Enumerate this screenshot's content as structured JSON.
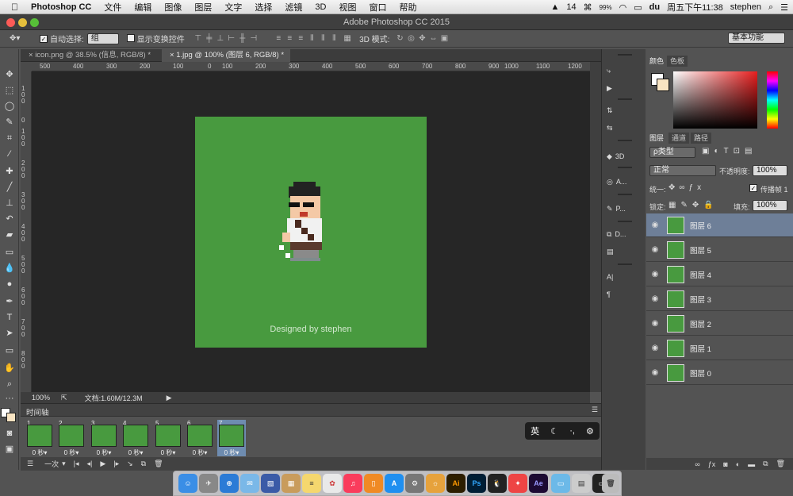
{
  "menubar": {
    "apple": "",
    "app": "Photoshop CC",
    "items": [
      "文件",
      "编辑",
      "图像",
      "图层",
      "文字",
      "选择",
      "滤镜",
      "3D",
      "视图",
      "窗口",
      "帮助"
    ],
    "status": {
      "adobe_count": "14",
      "wechat": "⌘",
      "battery": "99%",
      "clock": "周五下午11:38",
      "user": "stephen"
    }
  },
  "window": {
    "title": "Adobe Photoshop CC 2015"
  },
  "options": {
    "auto_select_label": "自动选择:",
    "auto_select_value": "组",
    "show_transform_label": "显示变换控件",
    "mode3d_label": "3D 模式:",
    "workspace": "基本功能"
  },
  "tabs": [
    {
      "label": "icon.png @ 38.5% (信息, RGB/8) *"
    },
    {
      "label": "1.jpg @ 100% (图层 6, RGB/8) *"
    }
  ],
  "ruler": {
    "h": [
      "500",
      "400",
      "300",
      "200",
      "100",
      "0",
      "100",
      "200",
      "300",
      "400",
      "500",
      "600",
      "700",
      "800",
      "900",
      "1000",
      "1100",
      "1200"
    ],
    "v": [
      "1 0 0",
      "0",
      "1 0 0",
      "2 0 0",
      "3 0 0",
      "4 0 0",
      "5 0 0",
      "6 0 0",
      "7 0 0",
      "8 0 0"
    ]
  },
  "canvas": {
    "bg_color": "#489a3f",
    "credit": "Designed by stephen"
  },
  "docstatus": {
    "zoom": "100%",
    "doc": "文档:1.60M/12.3M"
  },
  "timeline": {
    "title": "时间轴",
    "frames": [
      {
        "n": "1",
        "d": "0 秒▾"
      },
      {
        "n": "2",
        "d": "0 秒▾"
      },
      {
        "n": "3",
        "d": "0 秒▾"
      },
      {
        "n": "4",
        "d": "0 秒▾"
      },
      {
        "n": "5",
        "d": "0 秒▾"
      },
      {
        "n": "6",
        "d": "0 秒▾"
      },
      {
        "n": "7",
        "d": "0 秒▾"
      }
    ],
    "loop": "一次"
  },
  "ime": {
    "lang": "英"
  },
  "iconcol": {
    "items": [
      {
        "label": "3D"
      },
      {
        "label": "A..."
      },
      {
        "label": "P..."
      },
      {
        "label": "D..."
      }
    ]
  },
  "color": {
    "tabs": [
      "颜色",
      "色板"
    ]
  },
  "layers": {
    "tabs": [
      "图层",
      "通道",
      "路径"
    ],
    "filter": "ρ类型",
    "blend": "正常",
    "opacity_label": "不透明度:",
    "opacity": "100%",
    "unify_label": "统一:",
    "propagate_label": "传播帧 1",
    "lock_label": "锁定:",
    "fill_label": "填充:",
    "fill": "100%",
    "items": [
      {
        "name": "图层 6"
      },
      {
        "name": "图层 5"
      },
      {
        "name": "图层 4"
      },
      {
        "name": "图层 3"
      },
      {
        "name": "图层 2"
      },
      {
        "name": "图层 1"
      },
      {
        "name": "图层 0"
      }
    ]
  }
}
